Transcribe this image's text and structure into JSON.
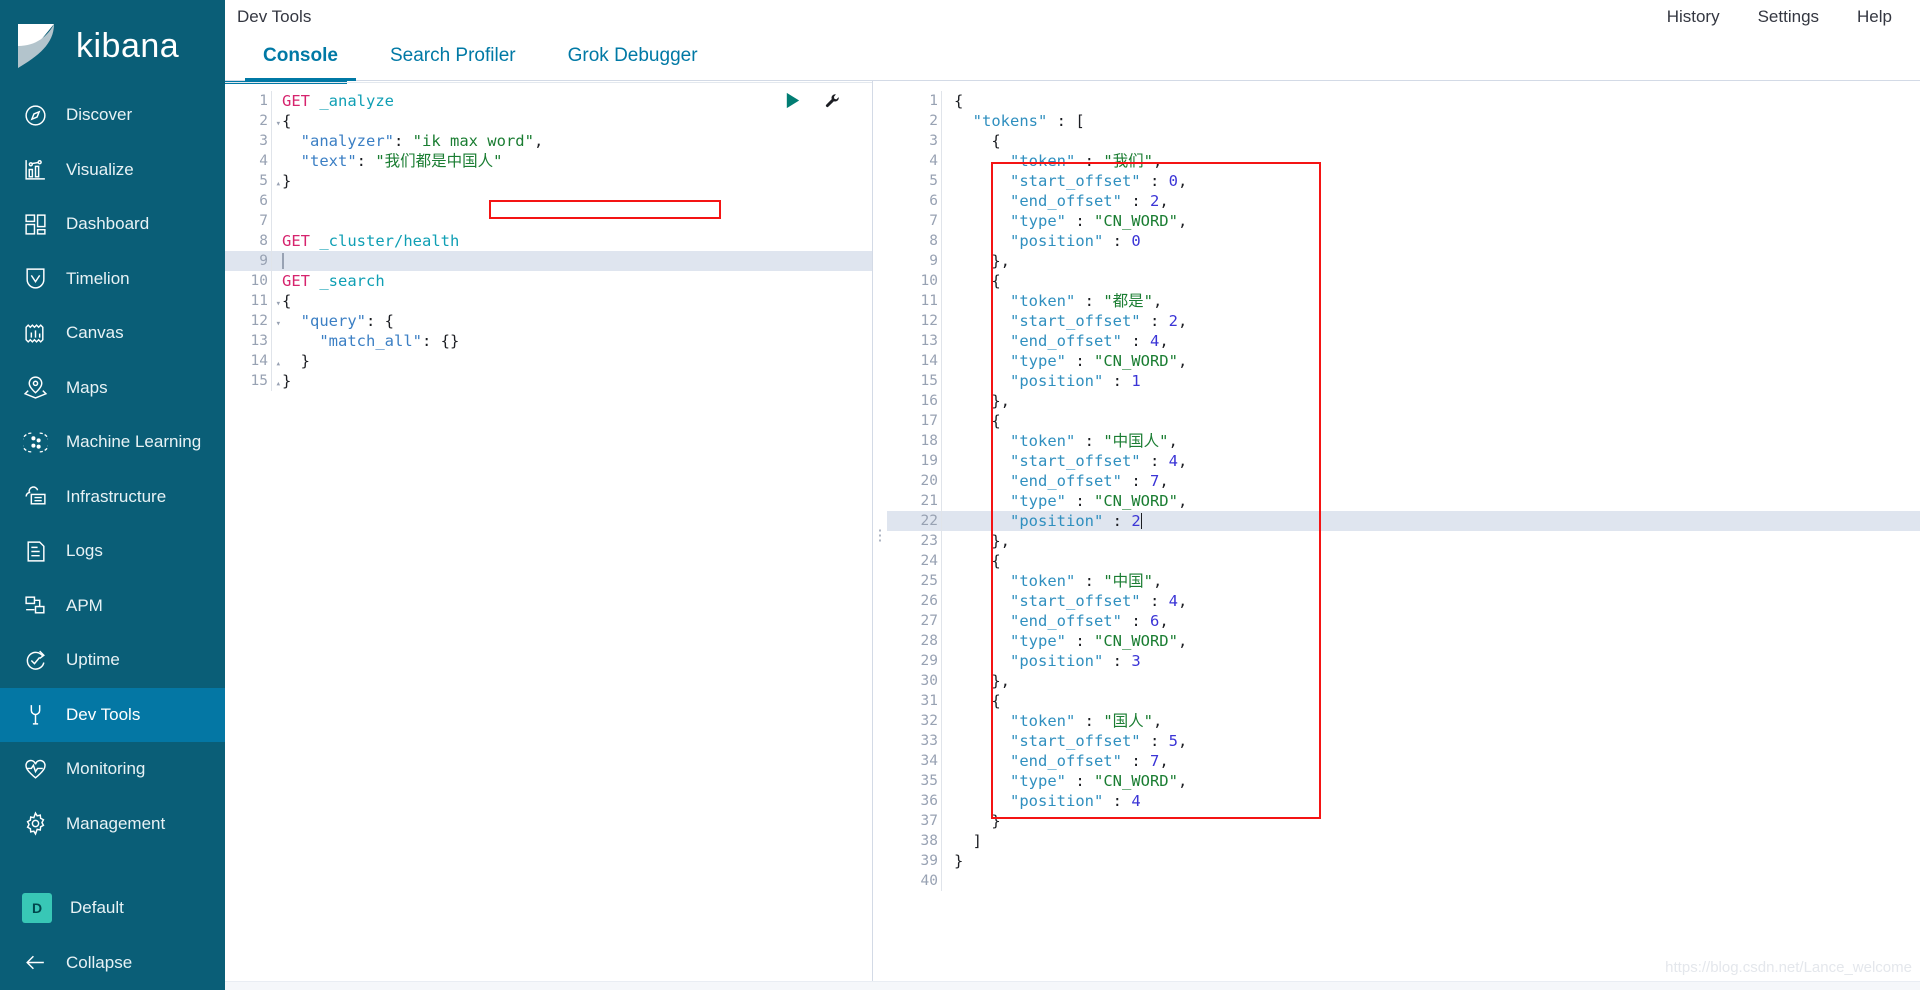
{
  "sidebar": {
    "brand": "kibana",
    "items": [
      {
        "label": "Discover",
        "icon": "compass-icon",
        "active": false
      },
      {
        "label": "Visualize",
        "icon": "bar-chart-icon",
        "active": false
      },
      {
        "label": "Dashboard",
        "icon": "dashboard-icon",
        "active": false
      },
      {
        "label": "Timelion",
        "icon": "timelion-icon",
        "active": false
      },
      {
        "label": "Canvas",
        "icon": "canvas-icon",
        "active": false
      },
      {
        "label": "Maps",
        "icon": "map-marker-icon",
        "active": false
      },
      {
        "label": "Machine Learning",
        "icon": "machine-learning-icon",
        "active": false
      },
      {
        "label": "Infrastructure",
        "icon": "infrastructure-icon",
        "active": false
      },
      {
        "label": "Logs",
        "icon": "logs-icon",
        "active": false
      },
      {
        "label": "APM",
        "icon": "apm-icon",
        "active": false
      },
      {
        "label": "Uptime",
        "icon": "uptime-icon",
        "active": false
      },
      {
        "label": "Dev Tools",
        "icon": "wrench-icon",
        "active": true
      },
      {
        "label": "Monitoring",
        "icon": "heartbeat-icon",
        "active": false
      },
      {
        "label": "Management",
        "icon": "gear-icon",
        "active": false
      }
    ],
    "space": {
      "label": "Default",
      "initial": "D"
    },
    "collapse": {
      "label": "Collapse",
      "icon": "arrow-left-icon"
    }
  },
  "header": {
    "title": "Dev Tools",
    "links": [
      "History",
      "Settings",
      "Help"
    ]
  },
  "tabs": [
    {
      "label": "Console",
      "active": true
    },
    {
      "label": "Search Profiler",
      "active": false
    },
    {
      "label": "Grok Debugger",
      "active": false
    }
  ],
  "colors": {
    "sidebar_bg": "#0a5e77",
    "sidebar_active": "#0477a4",
    "accent": "#0079a5",
    "space_badge": "#38c7b6",
    "highlight_box": "#f41414",
    "active_line": "#dfe5ef",
    "method": "#d6246e",
    "url": "#0f9fb4",
    "json_key": "#3b7fc4",
    "json_string": "#1a7d32",
    "json_number": "#3a34d6"
  },
  "request_editor": {
    "name": "console-request-editor",
    "active_line": 9,
    "lines": [
      {
        "n": 1,
        "fold": "",
        "tokens": [
          {
            "c": "t-method",
            "t": "GET"
          },
          {
            "c": "t-plain",
            "t": " "
          },
          {
            "c": "t-url",
            "t": "_analyze"
          }
        ]
      },
      {
        "n": 2,
        "fold": "▾",
        "tokens": [
          {
            "c": "t-punc",
            "t": "{"
          }
        ]
      },
      {
        "n": 3,
        "fold": "",
        "tokens": [
          {
            "c": "t-key",
            "t": "  \"analyzer\""
          },
          {
            "c": "t-punc",
            "t": ": "
          },
          {
            "c": "t-str",
            "t": "\"ik max word\""
          },
          {
            "c": "t-punc",
            "t": ","
          }
        ]
      },
      {
        "n": 4,
        "fold": "",
        "tokens": [
          {
            "c": "t-key",
            "t": "  \"text\""
          },
          {
            "c": "t-punc",
            "t": ": "
          },
          {
            "c": "t-str",
            "t": "\"我们都是中国人\""
          }
        ]
      },
      {
        "n": 5,
        "fold": "▴",
        "tokens": [
          {
            "c": "t-punc",
            "t": "}"
          }
        ]
      },
      {
        "n": 6,
        "fold": "",
        "tokens": []
      },
      {
        "n": 7,
        "fold": "",
        "tokens": []
      },
      {
        "n": 8,
        "fold": "",
        "tokens": [
          {
            "c": "t-method",
            "t": "GET"
          },
          {
            "c": "t-plain",
            "t": " "
          },
          {
            "c": "t-url",
            "t": "_cluster/health"
          }
        ]
      },
      {
        "n": 9,
        "fold": "",
        "tokens": [],
        "cursor": true
      },
      {
        "n": 10,
        "fold": "",
        "tokens": [
          {
            "c": "t-method",
            "t": "GET"
          },
          {
            "c": "t-plain",
            "t": " "
          },
          {
            "c": "t-url",
            "t": "_search"
          }
        ]
      },
      {
        "n": 11,
        "fold": "▾",
        "tokens": [
          {
            "c": "t-punc",
            "t": "{"
          }
        ]
      },
      {
        "n": 12,
        "fold": "▾",
        "tokens": [
          {
            "c": "t-key",
            "t": "  \"query\""
          },
          {
            "c": "t-punc",
            "t": ": {"
          }
        ]
      },
      {
        "n": 13,
        "fold": "",
        "tokens": [
          {
            "c": "t-key",
            "t": "    \"match_all\""
          },
          {
            "c": "t-punc",
            "t": ": {}"
          }
        ]
      },
      {
        "n": 14,
        "fold": "▴",
        "tokens": [
          {
            "c": "t-punc",
            "t": "  }"
          }
        ]
      },
      {
        "n": 15,
        "fold": "▴",
        "tokens": [
          {
            "c": "t-punc",
            "t": "}"
          }
        ]
      }
    ],
    "actions": {
      "play": "play-icon",
      "wrench": "wrench-icon"
    }
  },
  "response_editor": {
    "name": "console-response-editor",
    "active_line": 22,
    "lines": [
      {
        "n": 1,
        "fold": "▾",
        "tokens": [
          {
            "c": "t-punc",
            "t": "{"
          }
        ]
      },
      {
        "n": 2,
        "fold": "▾",
        "tokens": [
          {
            "c": "t-key2",
            "t": "  \"tokens\""
          },
          {
            "c": "t-punc",
            "t": " : ["
          }
        ]
      },
      {
        "n": 3,
        "fold": "▾",
        "tokens": [
          {
            "c": "t-punc",
            "t": "    {"
          }
        ]
      },
      {
        "n": 4,
        "fold": "",
        "tokens": [
          {
            "c": "t-key2",
            "t": "      \"token\""
          },
          {
            "c": "t-punc",
            "t": " : "
          },
          {
            "c": "t-str",
            "t": "\"我们\""
          },
          {
            "c": "t-punc",
            "t": ","
          }
        ]
      },
      {
        "n": 5,
        "fold": "",
        "tokens": [
          {
            "c": "t-key2",
            "t": "      \"start_offset\""
          },
          {
            "c": "t-punc",
            "t": " : "
          },
          {
            "c": "t-num",
            "t": "0"
          },
          {
            "c": "t-punc",
            "t": ","
          }
        ]
      },
      {
        "n": 6,
        "fold": "",
        "tokens": [
          {
            "c": "t-key2",
            "t": "      \"end_offset\""
          },
          {
            "c": "t-punc",
            "t": " : "
          },
          {
            "c": "t-num",
            "t": "2"
          },
          {
            "c": "t-punc",
            "t": ","
          }
        ]
      },
      {
        "n": 7,
        "fold": "",
        "tokens": [
          {
            "c": "t-key2",
            "t": "      \"type\""
          },
          {
            "c": "t-punc",
            "t": " : "
          },
          {
            "c": "t-str",
            "t": "\"CN_WORD\""
          },
          {
            "c": "t-punc",
            "t": ","
          }
        ]
      },
      {
        "n": 8,
        "fold": "",
        "tokens": [
          {
            "c": "t-key2",
            "t": "      \"position\""
          },
          {
            "c": "t-punc",
            "t": " : "
          },
          {
            "c": "t-num",
            "t": "0"
          }
        ]
      },
      {
        "n": 9,
        "fold": "▴",
        "tokens": [
          {
            "c": "t-punc",
            "t": "    },"
          }
        ]
      },
      {
        "n": 10,
        "fold": "▾",
        "tokens": [
          {
            "c": "t-punc",
            "t": "    {"
          }
        ]
      },
      {
        "n": 11,
        "fold": "",
        "tokens": [
          {
            "c": "t-key2",
            "t": "      \"token\""
          },
          {
            "c": "t-punc",
            "t": " : "
          },
          {
            "c": "t-str",
            "t": "\"都是\""
          },
          {
            "c": "t-punc",
            "t": ","
          }
        ]
      },
      {
        "n": 12,
        "fold": "",
        "tokens": [
          {
            "c": "t-key2",
            "t": "      \"start_offset\""
          },
          {
            "c": "t-punc",
            "t": " : "
          },
          {
            "c": "t-num",
            "t": "2"
          },
          {
            "c": "t-punc",
            "t": ","
          }
        ]
      },
      {
        "n": 13,
        "fold": "",
        "tokens": [
          {
            "c": "t-key2",
            "t": "      \"end_offset\""
          },
          {
            "c": "t-punc",
            "t": " : "
          },
          {
            "c": "t-num",
            "t": "4"
          },
          {
            "c": "t-punc",
            "t": ","
          }
        ]
      },
      {
        "n": 14,
        "fold": "",
        "tokens": [
          {
            "c": "t-key2",
            "t": "      \"type\""
          },
          {
            "c": "t-punc",
            "t": " : "
          },
          {
            "c": "t-str",
            "t": "\"CN_WORD\""
          },
          {
            "c": "t-punc",
            "t": ","
          }
        ]
      },
      {
        "n": 15,
        "fold": "",
        "tokens": [
          {
            "c": "t-key2",
            "t": "      \"position\""
          },
          {
            "c": "t-punc",
            "t": " : "
          },
          {
            "c": "t-num",
            "t": "1"
          }
        ]
      },
      {
        "n": 16,
        "fold": "▴",
        "tokens": [
          {
            "c": "t-punc",
            "t": "    },"
          }
        ]
      },
      {
        "n": 17,
        "fold": "▾",
        "tokens": [
          {
            "c": "t-punc",
            "t": "    {"
          }
        ]
      },
      {
        "n": 18,
        "fold": "",
        "tokens": [
          {
            "c": "t-key2",
            "t": "      \"token\""
          },
          {
            "c": "t-punc",
            "t": " : "
          },
          {
            "c": "t-str",
            "t": "\"中国人\""
          },
          {
            "c": "t-punc",
            "t": ","
          }
        ]
      },
      {
        "n": 19,
        "fold": "",
        "tokens": [
          {
            "c": "t-key2",
            "t": "      \"start_offset\""
          },
          {
            "c": "t-punc",
            "t": " : "
          },
          {
            "c": "t-num",
            "t": "4"
          },
          {
            "c": "t-punc",
            "t": ","
          }
        ]
      },
      {
        "n": 20,
        "fold": "",
        "tokens": [
          {
            "c": "t-key2",
            "t": "      \"end_offset\""
          },
          {
            "c": "t-punc",
            "t": " : "
          },
          {
            "c": "t-num",
            "t": "7"
          },
          {
            "c": "t-punc",
            "t": ","
          }
        ]
      },
      {
        "n": 21,
        "fold": "",
        "tokens": [
          {
            "c": "t-key2",
            "t": "      \"type\""
          },
          {
            "c": "t-punc",
            "t": " : "
          },
          {
            "c": "t-str",
            "t": "\"CN_WORD\""
          },
          {
            "c": "t-punc",
            "t": ","
          }
        ]
      },
      {
        "n": 22,
        "fold": "",
        "tokens": [
          {
            "c": "t-key2",
            "t": "      \"position\""
          },
          {
            "c": "t-punc",
            "t": " : "
          },
          {
            "c": "t-num",
            "t": "2"
          }
        ],
        "cursor": true
      },
      {
        "n": 23,
        "fold": "▴",
        "tokens": [
          {
            "c": "t-punc",
            "t": "    },"
          }
        ]
      },
      {
        "n": 24,
        "fold": "▾",
        "tokens": [
          {
            "c": "t-punc",
            "t": "    {"
          }
        ]
      },
      {
        "n": 25,
        "fold": "",
        "tokens": [
          {
            "c": "t-key2",
            "t": "      \"token\""
          },
          {
            "c": "t-punc",
            "t": " : "
          },
          {
            "c": "t-str",
            "t": "\"中国\""
          },
          {
            "c": "t-punc",
            "t": ","
          }
        ]
      },
      {
        "n": 26,
        "fold": "",
        "tokens": [
          {
            "c": "t-key2",
            "t": "      \"start_offset\""
          },
          {
            "c": "t-punc",
            "t": " : "
          },
          {
            "c": "t-num",
            "t": "4"
          },
          {
            "c": "t-punc",
            "t": ","
          }
        ]
      },
      {
        "n": 27,
        "fold": "",
        "tokens": [
          {
            "c": "t-key2",
            "t": "      \"end_offset\""
          },
          {
            "c": "t-punc",
            "t": " : "
          },
          {
            "c": "t-num",
            "t": "6"
          },
          {
            "c": "t-punc",
            "t": ","
          }
        ]
      },
      {
        "n": 28,
        "fold": "",
        "tokens": [
          {
            "c": "t-key2",
            "t": "      \"type\""
          },
          {
            "c": "t-punc",
            "t": " : "
          },
          {
            "c": "t-str",
            "t": "\"CN_WORD\""
          },
          {
            "c": "t-punc",
            "t": ","
          }
        ]
      },
      {
        "n": 29,
        "fold": "",
        "tokens": [
          {
            "c": "t-key2",
            "t": "      \"position\""
          },
          {
            "c": "t-punc",
            "t": " : "
          },
          {
            "c": "t-num",
            "t": "3"
          }
        ]
      },
      {
        "n": 30,
        "fold": "▴",
        "tokens": [
          {
            "c": "t-punc",
            "t": "    },"
          }
        ]
      },
      {
        "n": 31,
        "fold": "▾",
        "tokens": [
          {
            "c": "t-punc",
            "t": "    {"
          }
        ]
      },
      {
        "n": 32,
        "fold": "",
        "tokens": [
          {
            "c": "t-key2",
            "t": "      \"token\""
          },
          {
            "c": "t-punc",
            "t": " : "
          },
          {
            "c": "t-str",
            "t": "\"国人\""
          },
          {
            "c": "t-punc",
            "t": ","
          }
        ]
      },
      {
        "n": 33,
        "fold": "",
        "tokens": [
          {
            "c": "t-key2",
            "t": "      \"start_offset\""
          },
          {
            "c": "t-punc",
            "t": " : "
          },
          {
            "c": "t-num",
            "t": "5"
          },
          {
            "c": "t-punc",
            "t": ","
          }
        ]
      },
      {
        "n": 34,
        "fold": "",
        "tokens": [
          {
            "c": "t-key2",
            "t": "      \"end_offset\""
          },
          {
            "c": "t-punc",
            "t": " : "
          },
          {
            "c": "t-num",
            "t": "7"
          },
          {
            "c": "t-punc",
            "t": ","
          }
        ]
      },
      {
        "n": 35,
        "fold": "",
        "tokens": [
          {
            "c": "t-key2",
            "t": "      \"type\""
          },
          {
            "c": "t-punc",
            "t": " : "
          },
          {
            "c": "t-str",
            "t": "\"CN_WORD\""
          },
          {
            "c": "t-punc",
            "t": ","
          }
        ]
      },
      {
        "n": 36,
        "fold": "",
        "tokens": [
          {
            "c": "t-key2",
            "t": "      \"position\""
          },
          {
            "c": "t-punc",
            "t": " : "
          },
          {
            "c": "t-num",
            "t": "4"
          }
        ]
      },
      {
        "n": 37,
        "fold": "▴",
        "tokens": [
          {
            "c": "t-punc",
            "t": "    }"
          }
        ]
      },
      {
        "n": 38,
        "fold": "",
        "tokens": [
          {
            "c": "t-punc",
            "t": "  ]"
          }
        ]
      },
      {
        "n": 39,
        "fold": "▴",
        "tokens": [
          {
            "c": "t-punc",
            "t": "}"
          }
        ]
      },
      {
        "n": 40,
        "fold": "",
        "tokens": []
      }
    ]
  },
  "watermark": "https://blog.csdn.net/Lance_welcome"
}
